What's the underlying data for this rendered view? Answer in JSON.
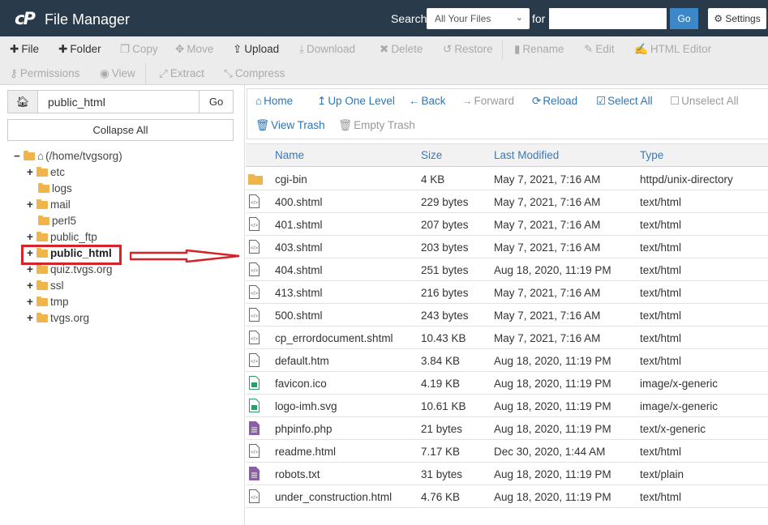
{
  "header": {
    "logo": "cP",
    "title": "File Manager",
    "search_label": "Search",
    "search_scope": "All Your Files",
    "for_label": "for",
    "search_value": "",
    "go": "Go",
    "settings": "Settings"
  },
  "toolbar": [
    {
      "label": "File",
      "icon": "plus-icon",
      "enabled": true
    },
    {
      "label": "Folder",
      "icon": "plus-icon",
      "enabled": true
    },
    {
      "label": "Copy",
      "icon": "copy-icon",
      "enabled": false
    },
    {
      "label": "Move",
      "icon": "move-icon",
      "enabled": false
    },
    {
      "label": "Upload",
      "icon": "upload-icon",
      "enabled": true
    },
    {
      "label": "Download",
      "icon": "download-icon",
      "enabled": false
    },
    {
      "label": "Delete",
      "icon": "delete-icon",
      "enabled": false
    },
    {
      "label": "Restore",
      "icon": "restore-icon",
      "enabled": false
    },
    {
      "label": "Rename",
      "icon": "rename-icon",
      "enabled": false
    },
    {
      "label": "Edit",
      "icon": "pencil-icon",
      "enabled": false
    },
    {
      "label": "HTML Editor",
      "icon": "html-editor-icon",
      "enabled": false
    },
    {
      "label": "Permissions",
      "icon": "key-icon",
      "enabled": false
    },
    {
      "label": "View",
      "icon": "eye-icon",
      "enabled": false
    },
    {
      "label": "Extract",
      "icon": "extract-icon",
      "enabled": false
    },
    {
      "label": "Compress",
      "icon": "compress-icon",
      "enabled": false
    }
  ],
  "sidebar": {
    "path_value": "public_html",
    "go": "Go",
    "collapse_all": "Collapse All",
    "tree": [
      {
        "label": "(/home/tvgsorg)",
        "expander": "−",
        "level": 0
      },
      {
        "label": "etc",
        "expander": "+",
        "level": 1
      },
      {
        "label": "logs",
        "expander": "",
        "level": 1
      },
      {
        "label": "mail",
        "expander": "+",
        "level": 1
      },
      {
        "label": "perl5",
        "expander": "",
        "level": 1
      },
      {
        "label": "public_ftp",
        "expander": "+",
        "level": 1
      },
      {
        "label": "public_html",
        "expander": "+",
        "level": 1,
        "selected": true
      },
      {
        "label": "quiz.tvgs.org",
        "expander": "+",
        "level": 1
      },
      {
        "label": "ssl",
        "expander": "+",
        "level": 1
      },
      {
        "label": "tmp",
        "expander": "+",
        "level": 1
      },
      {
        "label": "tvgs.org",
        "expander": "+",
        "level": 1
      }
    ]
  },
  "nav": [
    {
      "label": "Home",
      "icon": "home-icon",
      "enabled": true
    },
    {
      "label": "Up One Level",
      "icon": "up-arrow-icon",
      "enabled": true
    },
    {
      "label": "Back",
      "icon": "back-arrow-icon",
      "enabled": true
    },
    {
      "label": "Forward",
      "icon": "forward-arrow-icon",
      "enabled": false
    },
    {
      "label": "Reload",
      "icon": "reload-icon",
      "enabled": true
    },
    {
      "label": "Select All",
      "icon": "checkbox-checked-icon",
      "enabled": true
    },
    {
      "label": "Unselect All",
      "icon": "checkbox-icon",
      "enabled": false
    },
    {
      "label": "View Trash",
      "icon": "trash-icon",
      "enabled": true
    },
    {
      "label": "Empty Trash",
      "icon": "trash-icon",
      "enabled": false
    }
  ],
  "table": {
    "columns": [
      "Name",
      "Size",
      "Last Modified",
      "Type"
    ],
    "rows": [
      {
        "icon": "folder",
        "name": "cgi-bin",
        "size": "4 KB",
        "modified": "May 7, 2021, 7:16 AM",
        "type": "httpd/unix-directory"
      },
      {
        "icon": "html",
        "name": "400.shtml",
        "size": "229 bytes",
        "modified": "May 7, 2021, 7:16 AM",
        "type": "text/html"
      },
      {
        "icon": "html",
        "name": "401.shtml",
        "size": "207 bytes",
        "modified": "May 7, 2021, 7:16 AM",
        "type": "text/html"
      },
      {
        "icon": "html",
        "name": "403.shtml",
        "size": "203 bytes",
        "modified": "May 7, 2021, 7:16 AM",
        "type": "text/html"
      },
      {
        "icon": "html",
        "name": "404.shtml",
        "size": "251 bytes",
        "modified": "Aug 18, 2020, 11:19 PM",
        "type": "text/html"
      },
      {
        "icon": "html",
        "name": "413.shtml",
        "size": "216 bytes",
        "modified": "May 7, 2021, 7:16 AM",
        "type": "text/html"
      },
      {
        "icon": "html",
        "name": "500.shtml",
        "size": "243 bytes",
        "modified": "May 7, 2021, 7:16 AM",
        "type": "text/html"
      },
      {
        "icon": "html",
        "name": "cp_errordocument.shtml",
        "size": "10.43 KB",
        "modified": "May 7, 2021, 7:16 AM",
        "type": "text/html"
      },
      {
        "icon": "html",
        "name": "default.htm",
        "size": "3.84 KB",
        "modified": "Aug 18, 2020, 11:19 PM",
        "type": "text/html"
      },
      {
        "icon": "image",
        "name": "favicon.ico",
        "size": "4.19 KB",
        "modified": "Aug 18, 2020, 11:19 PM",
        "type": "image/x-generic"
      },
      {
        "icon": "image",
        "name": "logo-imh.svg",
        "size": "10.61 KB",
        "modified": "Aug 18, 2020, 11:19 PM",
        "type": "image/x-generic"
      },
      {
        "icon": "text",
        "name": "phpinfo.php",
        "size": "21 bytes",
        "modified": "Aug 18, 2020, 11:19 PM",
        "type": "text/x-generic"
      },
      {
        "icon": "html",
        "name": "readme.html",
        "size": "7.17 KB",
        "modified": "Dec 30, 2020, 1:44 AM",
        "type": "text/html"
      },
      {
        "icon": "text",
        "name": "robots.txt",
        "size": "31 bytes",
        "modified": "Aug 18, 2020, 11:19 PM",
        "type": "text/plain"
      },
      {
        "icon": "html",
        "name": "under_construction.html",
        "size": "4.76 KB",
        "modified": "Aug 18, 2020, 11:19 PM",
        "type": "text/html"
      }
    ]
  },
  "colors": {
    "header": "#293a4a",
    "accent": "#3b87c9",
    "link": "#2f74b5",
    "folder": "#f0b54a",
    "highlight": "#d4242a"
  }
}
